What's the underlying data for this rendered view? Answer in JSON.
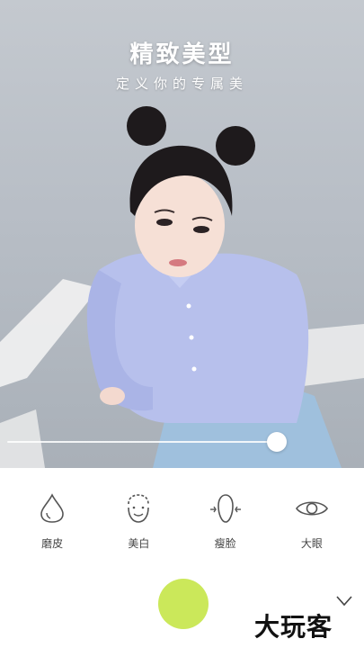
{
  "header": {
    "title": "精致美型",
    "subtitle": "定义你的专属美"
  },
  "slider": {
    "value": 0.75
  },
  "tools": [
    {
      "label": "磨皮",
      "icon": "drop-icon"
    },
    {
      "label": "美白",
      "icon": "face-smile-icon"
    },
    {
      "label": "瘦脸",
      "icon": "slim-face-icon"
    },
    {
      "label": "大眼",
      "icon": "eye-icon"
    }
  ],
  "shutter": {
    "color": "#cbe85a",
    "icon": "shutter-button"
  },
  "collapse": {
    "icon": "chevron-down-icon"
  },
  "watermark": {
    "text": "大玩客"
  }
}
